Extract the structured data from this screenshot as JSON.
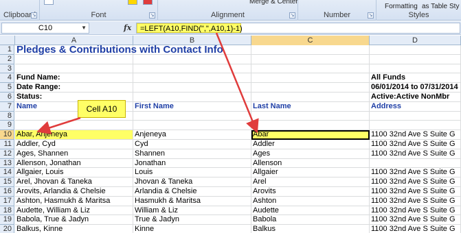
{
  "ribbon": {
    "groups": [
      {
        "label": "Clipboard"
      },
      {
        "label": "Font"
      },
      {
        "label": "Alignment"
      },
      {
        "label": "Number"
      },
      {
        "label": "Styles"
      }
    ],
    "merge_center_label": "Merge & Center",
    "formatting_label": "Formatting",
    "as_table_label": "as Table",
    "sty_label": "Sty"
  },
  "formula_bar": {
    "name_box": "C10",
    "fx": "fx",
    "formula": "=LEFT(A10,FIND(\",\",A10,1)-1)"
  },
  "columns": [
    "A",
    "B",
    "C",
    "D"
  ],
  "selected_column": "C",
  "rows": [
    {
      "num": "1",
      "A": "Pledges & Contributions with Contact Info",
      "B": "",
      "C": "",
      "D": ""
    },
    {
      "num": "2",
      "A": "",
      "B": "",
      "C": "",
      "D": ""
    },
    {
      "num": "3",
      "A": "",
      "B": "",
      "C": "",
      "D": ""
    },
    {
      "num": "4",
      "A": "Fund Name:",
      "B": "",
      "C": "",
      "D": "All Funds"
    },
    {
      "num": "5",
      "A": "Date Range:",
      "B": "",
      "C": "",
      "D": "06/01/2014 to 07/31/2014"
    },
    {
      "num": "6",
      "A": "Status:",
      "B": "",
      "C": "",
      "D": "Active:Active NonMbr"
    },
    {
      "num": "7",
      "A": "Name",
      "B": "First Name",
      "C": "Last Name",
      "D": "Address"
    },
    {
      "num": "8",
      "A": "",
      "B": "",
      "C": "",
      "D": ""
    },
    {
      "num": "9",
      "A": "",
      "B": "",
      "C": "",
      "D": ""
    },
    {
      "num": "10",
      "A": "Abar, Anjeneya",
      "B": "Anjeneya",
      "C": "Abar",
      "D": "1100 32nd Ave S Suite G"
    },
    {
      "num": "11",
      "A": "Addler, Cyd",
      "B": "Cyd",
      "C": "Addler",
      "D": "1100 32nd Ave S Suite G"
    },
    {
      "num": "12",
      "A": "Ages, Shannen",
      "B": "Shannen",
      "C": "Ages",
      "D": "1100 32nd Ave S Suite G"
    },
    {
      "num": "13",
      "A": "Allenson, Jonathan",
      "B": "Jonathan",
      "C": "Allenson",
      "D": ""
    },
    {
      "num": "14",
      "A": "Allgaier, Louis",
      "B": "Louis",
      "C": "Allgaier",
      "D": "1100 32nd Ave S Suite G"
    },
    {
      "num": "15",
      "A": "Arel, Jhovan & Taneka",
      "B": "Jhovan & Taneka",
      "C": "Arel",
      "D": "1100 32nd Ave S Suite G"
    },
    {
      "num": "16",
      "A": "Arovits, Arlandia & Chelsie",
      "B": "Arlandia & Chelsie",
      "C": "Arovits",
      "D": "1100 32nd Ave S Suite G"
    },
    {
      "num": "17",
      "A": "Ashton, Hasmukh & Maritsa",
      "B": "Hasmukh & Maritsa",
      "C": "Ashton",
      "D": "1100 32nd Ave S Suite G"
    },
    {
      "num": "18",
      "A": "Audette, William & Liz",
      "B": "William & Liz",
      "C": "Audette",
      "D": "1100 32nd Ave S Suite G"
    },
    {
      "num": "19",
      "A": "Babola, True & Jadyn",
      "B": "True & Jadyn",
      "C": "Babola",
      "D": "1100 32nd Ave S Suite G"
    },
    {
      "num": "20",
      "A": "Balkus, Kinne",
      "B": "Kinne",
      "C": "Balkus",
      "D": "1100 32nd Ave S Suite G"
    }
  ],
  "callout": {
    "text": "Cell A10"
  },
  "colors": {
    "highlight": "#ffff66",
    "header_blue": "#1f3fa6",
    "arrow": "#e03c3c"
  }
}
